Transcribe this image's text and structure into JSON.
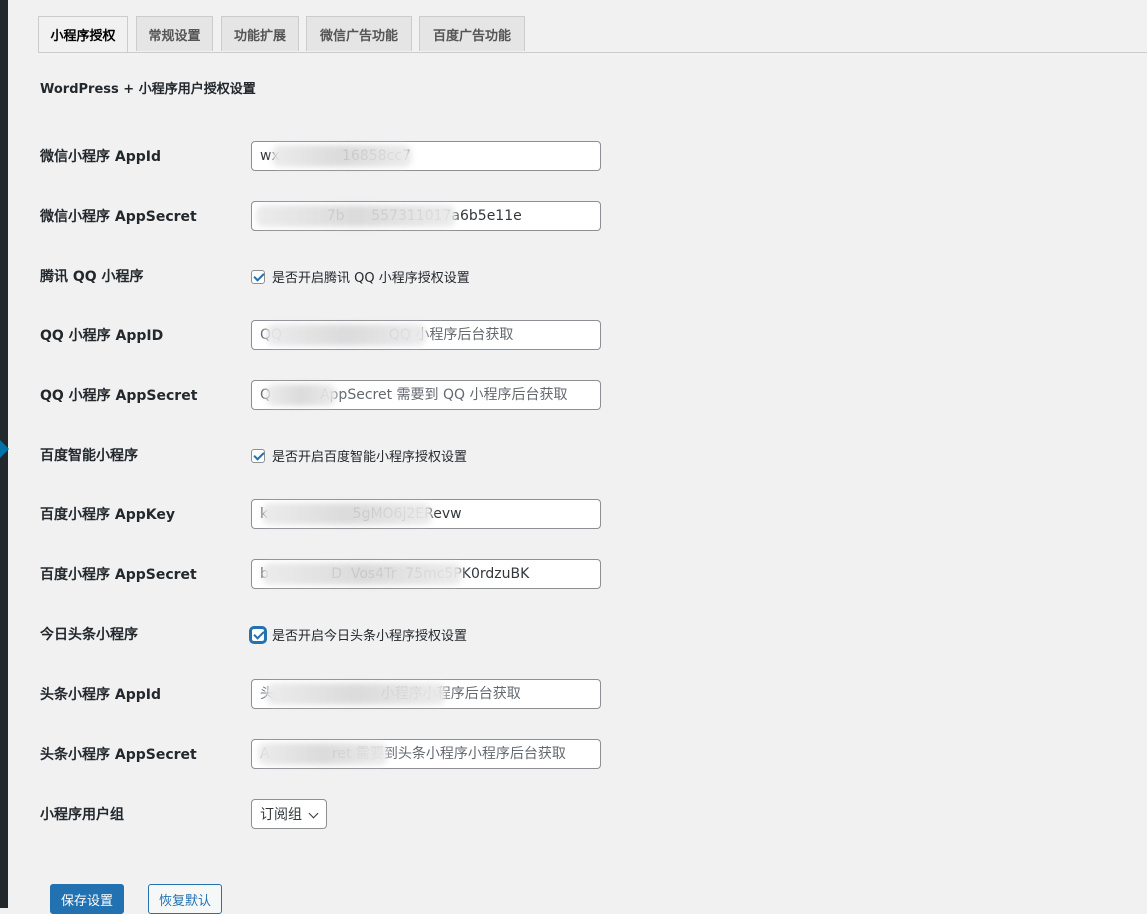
{
  "tabs": [
    {
      "label": "小程序授权",
      "active": true
    },
    {
      "label": "常规设置",
      "active": false
    },
    {
      "label": "功能扩展",
      "active": false
    },
    {
      "label": "微信广告功能",
      "active": false
    },
    {
      "label": "百度广告功能",
      "active": false
    }
  ],
  "section_title": "WordPress + 小程序用户授权设置",
  "fields": {
    "wx_appid": {
      "label": "微信小程序 AppId",
      "value": "wx              16858cc7"
    },
    "wx_appsecret": {
      "label": "微信小程序 AppSecret",
      "value": "               7b      557311017a6b5e11e"
    },
    "qq_enable": {
      "label": "腾讯 QQ 小程序",
      "text": "是否开启腾讯 QQ 小程序授权设置",
      "checked": true
    },
    "qq_appid": {
      "label": "QQ 小程序 AppID",
      "placeholder": "QQ                        QQ 小程序后台获取"
    },
    "qq_appsecret": {
      "label": "QQ 小程序 AppSecret",
      "placeholder": "Q           AppSecret 需要到 QQ 小程序后台获取"
    },
    "bd_enable": {
      "label": "百度智能小程序",
      "text": "是否开启百度智能小程序授权设置",
      "checked": true
    },
    "bd_appkey": {
      "label": "百度小程序 AppKey",
      "value": "k                   5gMO6j2ERevw"
    },
    "bd_appsecret": {
      "label": "百度小程序 AppSecret",
      "value": "b              D  Vos4Tr  75mc5PK0rdzuBK"
    },
    "tt_enable": {
      "label": "今日头条小程序",
      "text": "是否开启今日头条小程序授权设置",
      "checked": true
    },
    "tt_appid": {
      "label": "头条小程序 AppId",
      "placeholder": "头                        小程序小程序后台获取"
    },
    "tt_appsecret": {
      "label": "头条小程序 AppSecret",
      "placeholder": "A              ret 需要到头条小程序小程序后台获取"
    },
    "user_group": {
      "label": "小程序用户组",
      "selected": "订阅组"
    }
  },
  "buttons": {
    "save": "保存设置",
    "reset": "恢复默认"
  }
}
